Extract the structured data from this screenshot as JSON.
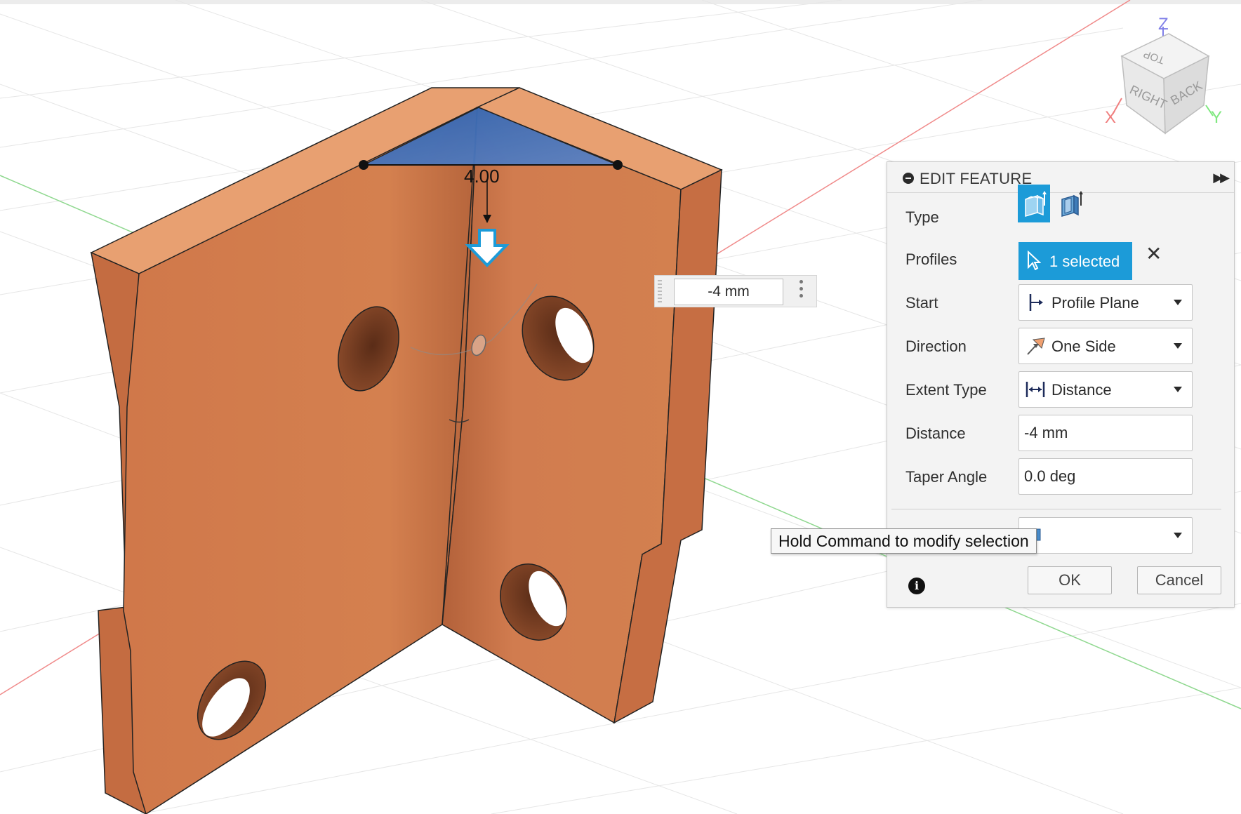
{
  "viewport": {
    "dimension_label": "4.00",
    "viewcube": {
      "top": "TOP",
      "right": "RIGHT",
      "back": "BACK",
      "axis_x": "X",
      "axis_y": "Y",
      "axis_z": "Z"
    },
    "floating_input_value": "-4 mm"
  },
  "panel": {
    "title": "EDIT FEATURE",
    "rows": {
      "type_label": "Type",
      "profiles_label": "Profiles",
      "profiles_value": "1 selected",
      "start_label": "Start",
      "start_value": "Profile Plane",
      "direction_label": "Direction",
      "direction_value": "One Side",
      "extent_type_label": "Extent Type",
      "extent_type_value": "Distance",
      "distance_label": "Distance",
      "distance_value": "-4 mm",
      "taper_angle_label": "Taper Angle",
      "taper_angle_value": "0.0 deg"
    },
    "ok_label": "OK",
    "cancel_label": "Cancel"
  },
  "tooltip": "Hold Command to modify selection",
  "colors": {
    "accent": "#1c9bd8",
    "part_face": "#d9875a",
    "part_top": "#e8a071",
    "profile_blue": "#3b6db3"
  }
}
